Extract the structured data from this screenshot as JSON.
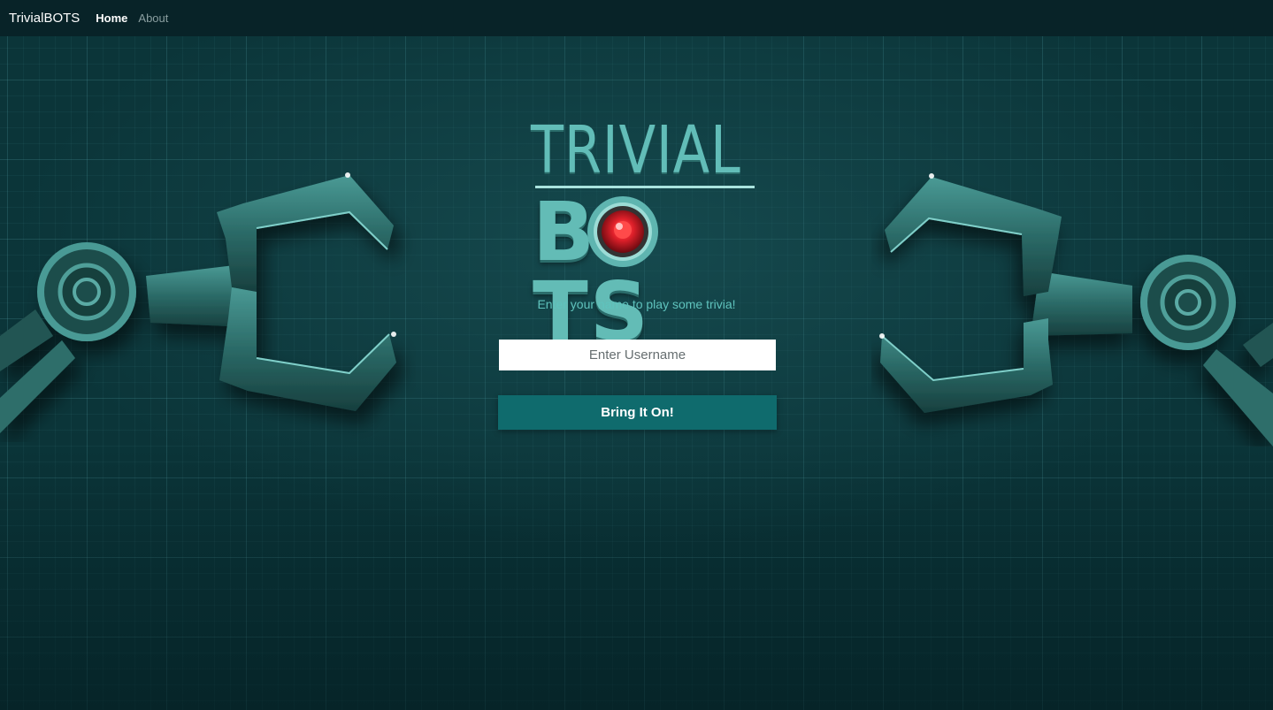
{
  "nav": {
    "brand": "TrivialBOTS",
    "links": [
      {
        "label": "Home",
        "active": true
      },
      {
        "label": "About",
        "active": false
      }
    ]
  },
  "logo": {
    "top_text": "TRIVIAL",
    "bottom_text_before": "B",
    "bottom_text_after": "TS"
  },
  "main": {
    "tagline": "Enter your name to play some trivia!",
    "username_placeholder": "Enter Username",
    "username_value": "",
    "submit_label": "Bring It On!"
  },
  "colors": {
    "background": "#0b3539",
    "navbar": "#082328",
    "accent_teal": "#62bdb8",
    "button": "#0f6b6d",
    "eye_red": "#e0202a"
  },
  "icons": {
    "left_decoration": "robot-claw-left-icon",
    "right_decoration": "robot-claw-right-icon",
    "logo_eye": "robot-eye-icon"
  }
}
